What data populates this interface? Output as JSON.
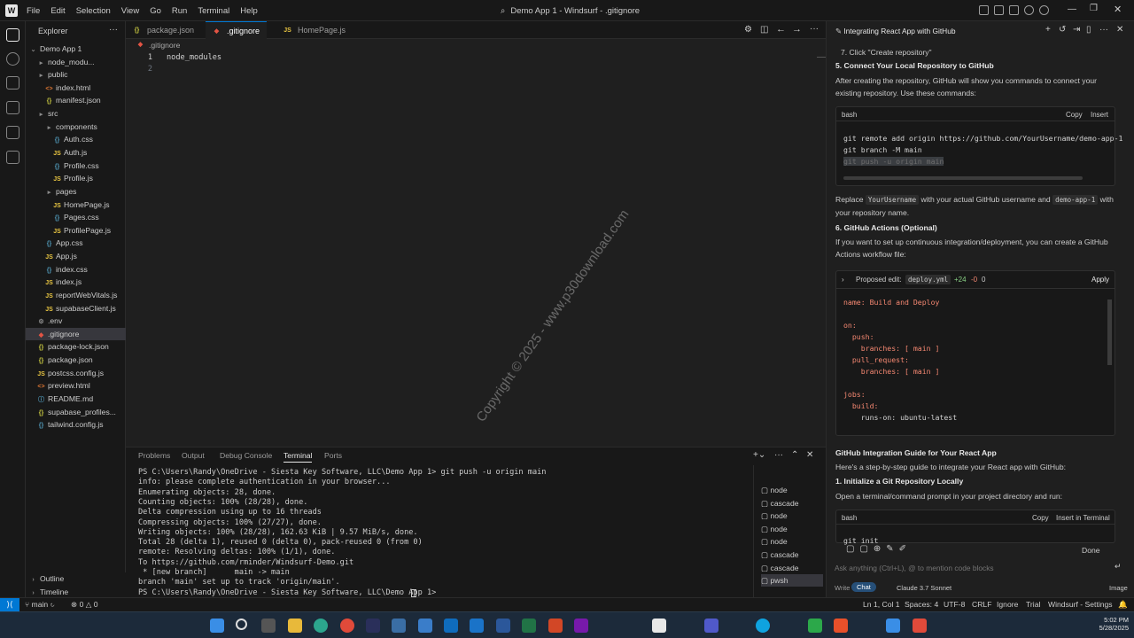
{
  "titlebar": {
    "menu": [
      "File",
      "Edit",
      "Selection",
      "View",
      "Go",
      "Run",
      "Terminal",
      "Help"
    ],
    "search": "Demo App 1 - Windsurf - .gitignore"
  },
  "explorer": {
    "header": "Explorer",
    "project": "Demo App 1",
    "items": [
      {
        "label": "node_modu...",
        "type": "fold",
        "depth": 1
      },
      {
        "label": "public",
        "type": "fold",
        "depth": 1
      },
      {
        "label": "index.html",
        "type": "html",
        "depth": 2
      },
      {
        "label": "manifest.json",
        "type": "json",
        "depth": 2
      },
      {
        "label": "src",
        "type": "fold",
        "depth": 1
      },
      {
        "label": "components",
        "type": "fold",
        "depth": 2
      },
      {
        "label": "Auth.css",
        "type": "css",
        "depth": 3
      },
      {
        "label": "Auth.js",
        "type": "js",
        "depth": 3
      },
      {
        "label": "Profile.css",
        "type": "css",
        "depth": 3
      },
      {
        "label": "Profile.js",
        "type": "js",
        "depth": 3
      },
      {
        "label": "pages",
        "type": "fold",
        "depth": 2
      },
      {
        "label": "HomePage.js",
        "type": "js",
        "depth": 3
      },
      {
        "label": "Pages.css",
        "type": "css",
        "depth": 3
      },
      {
        "label": "ProfilePage.js",
        "type": "js",
        "depth": 3
      },
      {
        "label": "App.css",
        "type": "css",
        "depth": 2
      },
      {
        "label": "App.js",
        "type": "js",
        "depth": 2
      },
      {
        "label": "index.css",
        "type": "css",
        "depth": 2
      },
      {
        "label": "index.js",
        "type": "js",
        "depth": 2
      },
      {
        "label": "reportWebVitals.js",
        "type": "js",
        "depth": 2
      },
      {
        "label": "supabaseClient.js",
        "type": "js",
        "depth": 2
      },
      {
        "label": ".env",
        "type": "env",
        "depth": 1
      },
      {
        "label": ".gitignore",
        "type": "git",
        "depth": 1
      },
      {
        "label": "package-lock.json",
        "type": "json",
        "depth": 1
      },
      {
        "label": "package.json",
        "type": "json",
        "depth": 1
      },
      {
        "label": "postcss.config.js",
        "type": "js",
        "depth": 1
      },
      {
        "label": "preview.html",
        "type": "html",
        "depth": 1
      },
      {
        "label": "README.md",
        "type": "md",
        "depth": 1
      },
      {
        "label": "supabase_profiles...",
        "type": "json",
        "depth": 1
      },
      {
        "label": "tailwind.config.js",
        "type": "css",
        "depth": 1
      }
    ],
    "outline": "Outline",
    "timeline": "Timeline"
  },
  "tabs": [
    ".gitignore",
    "package.json",
    "HomePage.js"
  ],
  "editor": {
    "breadcrumb": ".gitignore",
    "lines": [
      "node_modules",
      ""
    ],
    "watermark": "Copyright © 2025 - www.p30download.com"
  },
  "panel": {
    "tabs": [
      "Problems",
      "Output",
      "Debug Console",
      "Terminal",
      "Ports"
    ],
    "terminal": [
      "PS C:\\Users\\Randy\\OneDrive - Siesta Key Software, LLC\\Demo App 1> git push -u origin main",
      "info: please complete authentication in your browser...",
      "Enumerating objects: 28, done.",
      "Counting objects: 100% (28/28), done.",
      "Delta compression using up to 16 threads",
      "Compressing objects: 100% (27/27), done.",
      "Writing objects: 100% (28/28), 162.63 KiB | 9.57 MiB/s, done.",
      "Total 28 (delta 1), reused 0 (delta 0), pack-reused 0 (from 0)",
      "remote: Resolving deltas: 100% (1/1), done.",
      "To https://github.com/rminder/Windsurf-Demo.git",
      " * [new branch]      main -> main",
      "branch 'main' set up to track 'origin/main'.",
      "PS C:\\Users\\Randy\\OneDrive - Siesta Key Software, LLC\\Demo App 1> "
    ],
    "terminals": [
      "node",
      "cascade",
      "node",
      "node",
      "node",
      "cascade",
      "cascade",
      "pwsh"
    ]
  },
  "chat": {
    "title": "Integrating React App with GitHub",
    "step7": "7. Click \"Create repository\"",
    "h5": "5. Connect Your Local Repository to GitHub",
    "p5": "After creating the repository, GitHub will show you commands to connect your existing repository. Use these commands:",
    "code1_lang": "bash",
    "copy": "Copy",
    "insert": "Insert",
    "code1": [
      "git remote add origin https://github.com/YourUsername/demo-app-1",
      "git branch -M main",
      "git push -u origin main"
    ],
    "replace_a": "Replace",
    "replace_code1": "YourUsername",
    "replace_b": "with your actual GitHub username and",
    "replace_code2": "demo-app-1",
    "replace_c": "with your repository name.",
    "h6": "6. GitHub Actions (Optional)",
    "p6": "If you want to set up continuous integration/deployment, you can create a GitHub Actions workflow file:",
    "proposed": "Proposed edit:",
    "proposed_file": "deploy.yml",
    "plus": "+24",
    "minus": "-0",
    "zero": "0",
    "apply": "Apply",
    "yaml": [
      "name: Build and Deploy",
      "",
      "on:",
      "  push:",
      "    branches: [ main ]",
      "  pull_request:",
      "    branches: [ main ]",
      "",
      "jobs:",
      "  build:",
      "    runs-on: ubuntu-latest"
    ],
    "guide_title": "GitHub Integration Guide for Your React App",
    "guide_p": "Here's a step-by-step guide to integrate your React app with GitHub:",
    "h1": "1. Initialize a Git Repository Locally",
    "p1": "Open a terminal/command prompt in your project directory and run:",
    "code2_lang": "bash",
    "insert_terminal": "Insert in Terminal",
    "code2": "git init",
    "done": "Done",
    "input_placeholder": "Ask anything (Ctrl+L), @ to mention code blocks",
    "write": "Write",
    "chat_mode": "Chat",
    "model": "Claude 3.7 Sonnet",
    "image": "Image"
  },
  "status": {
    "branch": "main",
    "errors": "0",
    "warnings": "0",
    "position": "Ln 1, Col 1",
    "spaces": "Spaces: 4",
    "encoding": "UTF-8",
    "eol": "CRLF",
    "ignore": "Ignore",
    "trial": "Trial",
    "settings": "Windsurf - Settings"
  },
  "taskbar": {
    "time": "5:02 PM",
    "date": "5/28/2025"
  },
  "colors": {
    "accent": "#0078d4",
    "taskbar": "#1c2a3a"
  }
}
